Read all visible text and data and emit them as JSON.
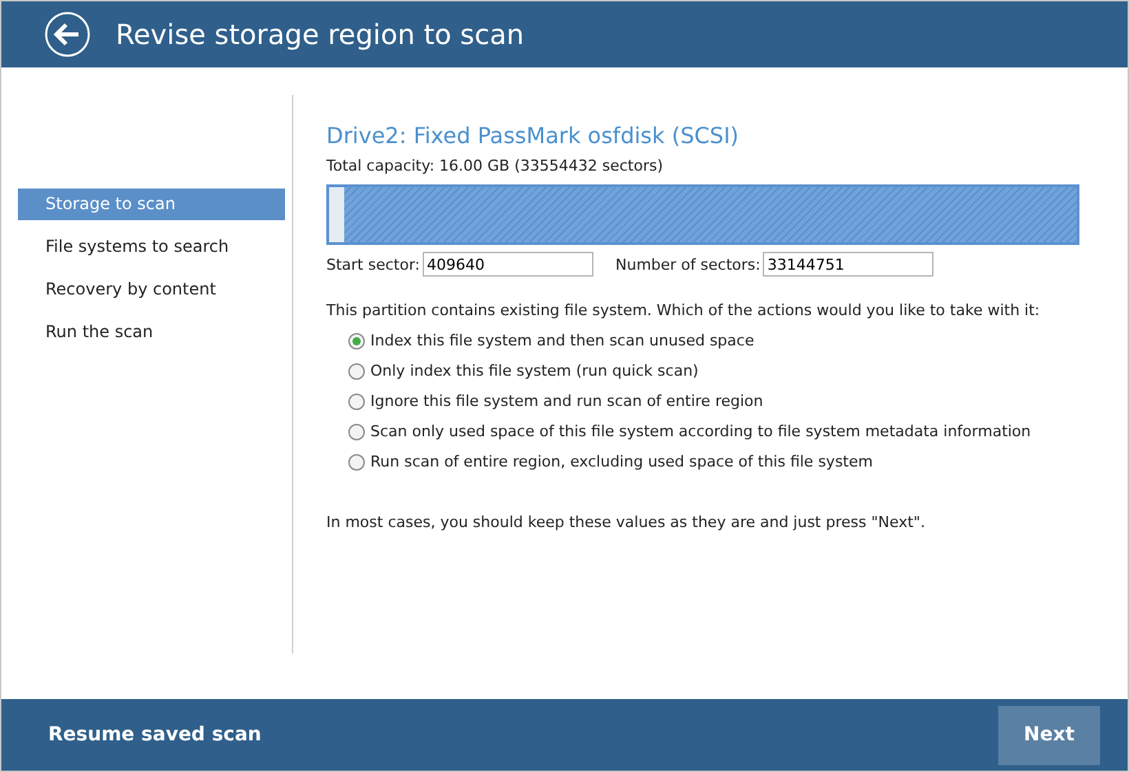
{
  "header": {
    "title": "Revise storage region to scan"
  },
  "sidebar": {
    "items": [
      {
        "label": "Storage to scan",
        "selected": true
      },
      {
        "label": "File systems to search",
        "selected": false
      },
      {
        "label": "Recovery by content",
        "selected": false
      },
      {
        "label": "Run the scan",
        "selected": false
      }
    ]
  },
  "drive": {
    "title": "Drive2: Fixed PassMark osfdisk (SCSI)",
    "capacity": "Total capacity: 16.00 GB (33554432 sectors)",
    "region": {
      "level": 0.98
    },
    "start_label": "Start sector:",
    "start_value": "409640",
    "count_label": "Number of sectors:",
    "count_value": "33144751"
  },
  "question": "This partition contains existing file system. Which of the actions would you like to take with it:",
  "options": [
    {
      "label": "Index this file system and then scan unused space",
      "selected": true
    },
    {
      "label": "Only index this file system (run quick scan)",
      "selected": false
    },
    {
      "label": "Ignore this file system and run scan of entire region",
      "selected": false
    },
    {
      "label": "Scan only used space of this file system according to file system metadata information",
      "selected": false
    },
    {
      "label": "Run scan of entire region, excluding used space of this file system",
      "selected": false
    }
  ],
  "hint": "In most cases, you should keep these values as they are and just press \"Next\".",
  "footer": {
    "left": "Resume saved scan",
    "next": "Next"
  }
}
